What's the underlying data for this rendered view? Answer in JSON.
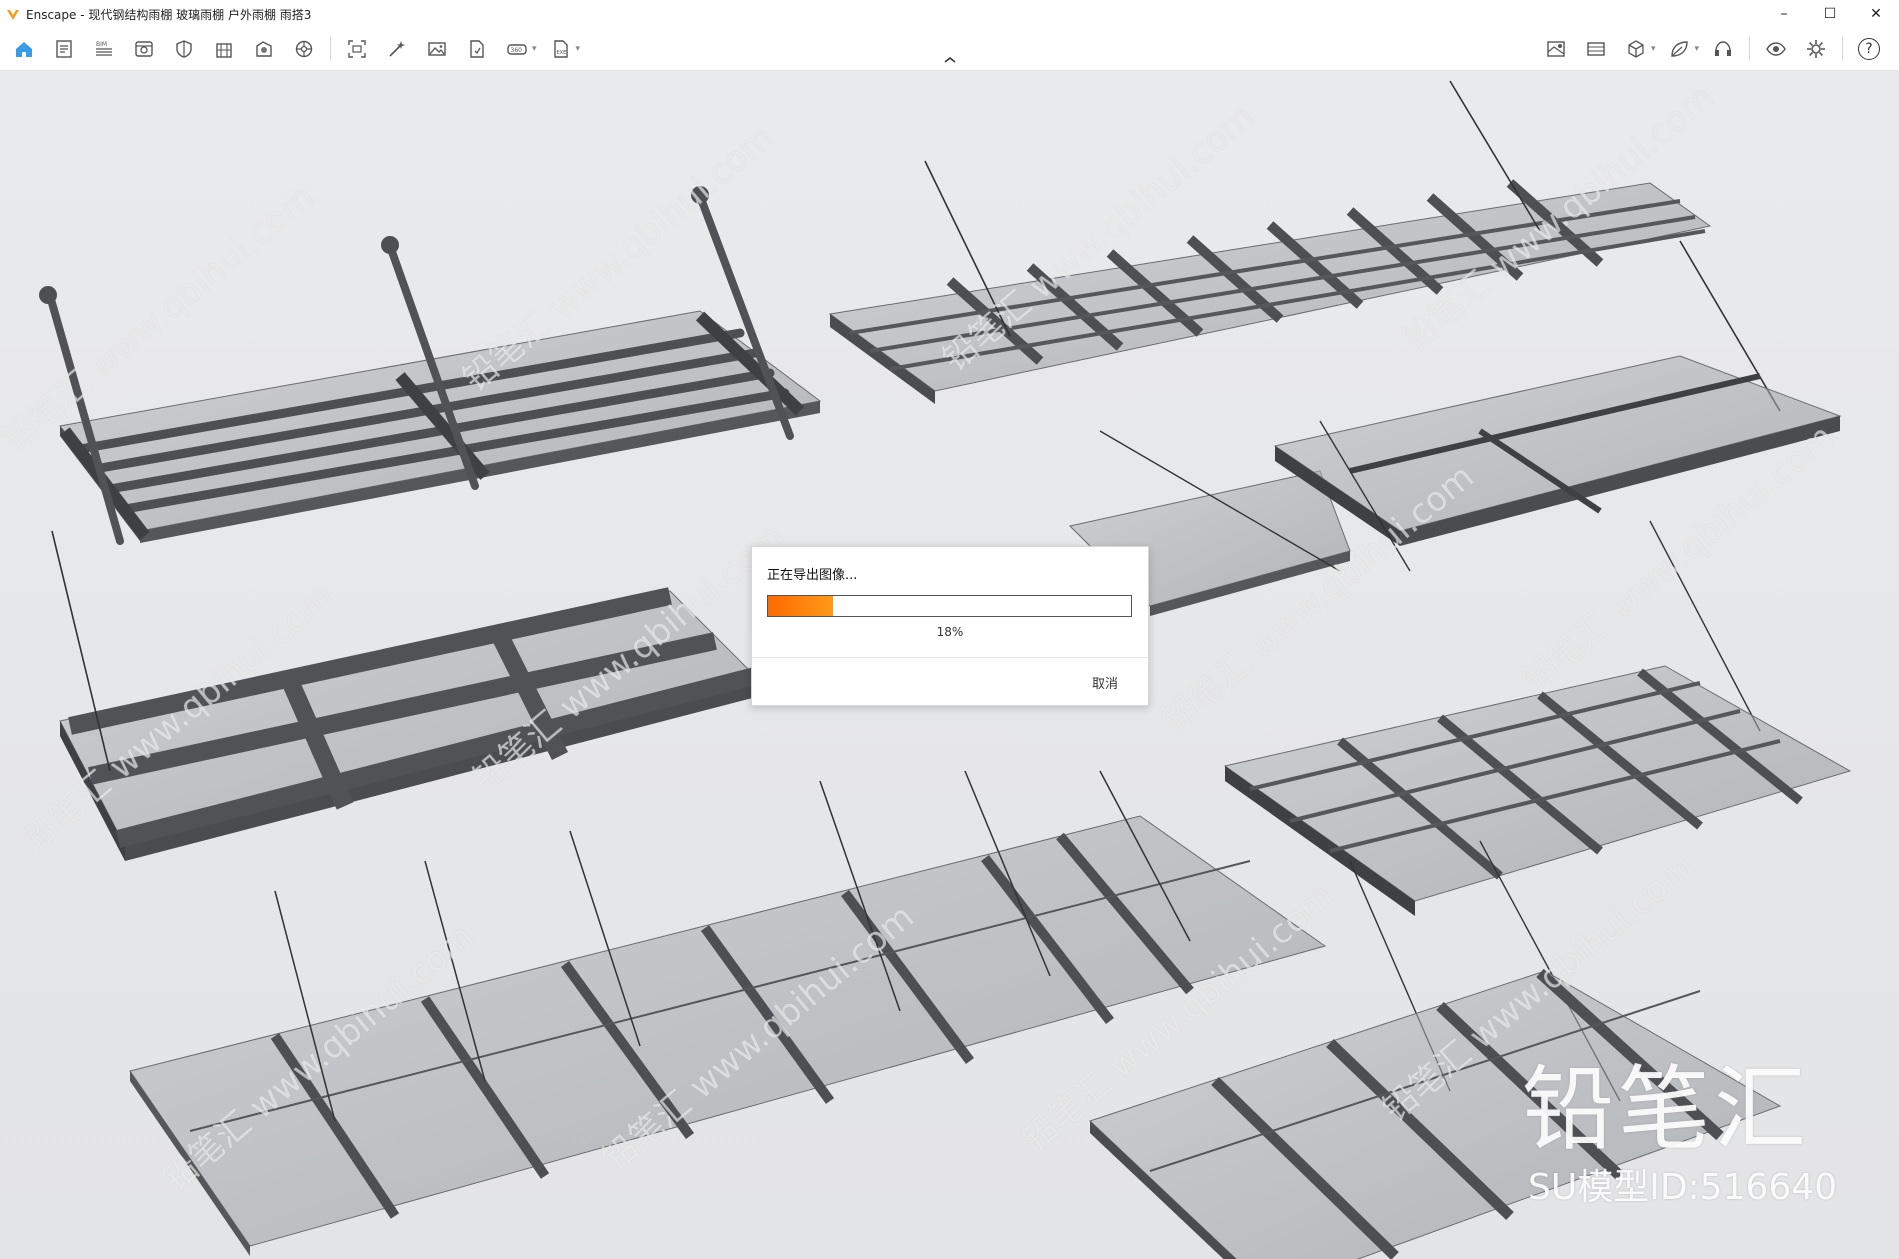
{
  "window": {
    "title": "Enscape - 现代钢结构雨棚 玻璃雨棚 户外雨棚 雨搭3",
    "controls": {
      "minimize": "–",
      "maximize": "☐",
      "close": "✕"
    }
  },
  "toolbar": {
    "left_icons": [
      "home-icon",
      "document-icon",
      "bim-icon",
      "visual-settings-icon",
      "shield-icon",
      "building-icon",
      "materials-icon",
      "asset-library-icon",
      "screenshot-icon",
      "magic-wand-icon",
      "image-icon",
      "file-export-icon",
      "vr-icon",
      "exe-export-icon"
    ],
    "right_icons": [
      "map-icon",
      "panorama-icon",
      "cube-icon",
      "leaf-icon",
      "headset-icon",
      "eye-icon",
      "gear-icon"
    ],
    "help_label": "?"
  },
  "dialog": {
    "title": "正在导出图像...",
    "progress_value": 0.18,
    "progress_label": "18%",
    "cancel_label": "取消",
    "accent_color": "#ff7a00"
  },
  "watermark": {
    "logo_text": "铅笔汇",
    "id_text": "SU模型ID:516640",
    "diagonal_text": "铅笔汇 www.qbihui.com"
  }
}
